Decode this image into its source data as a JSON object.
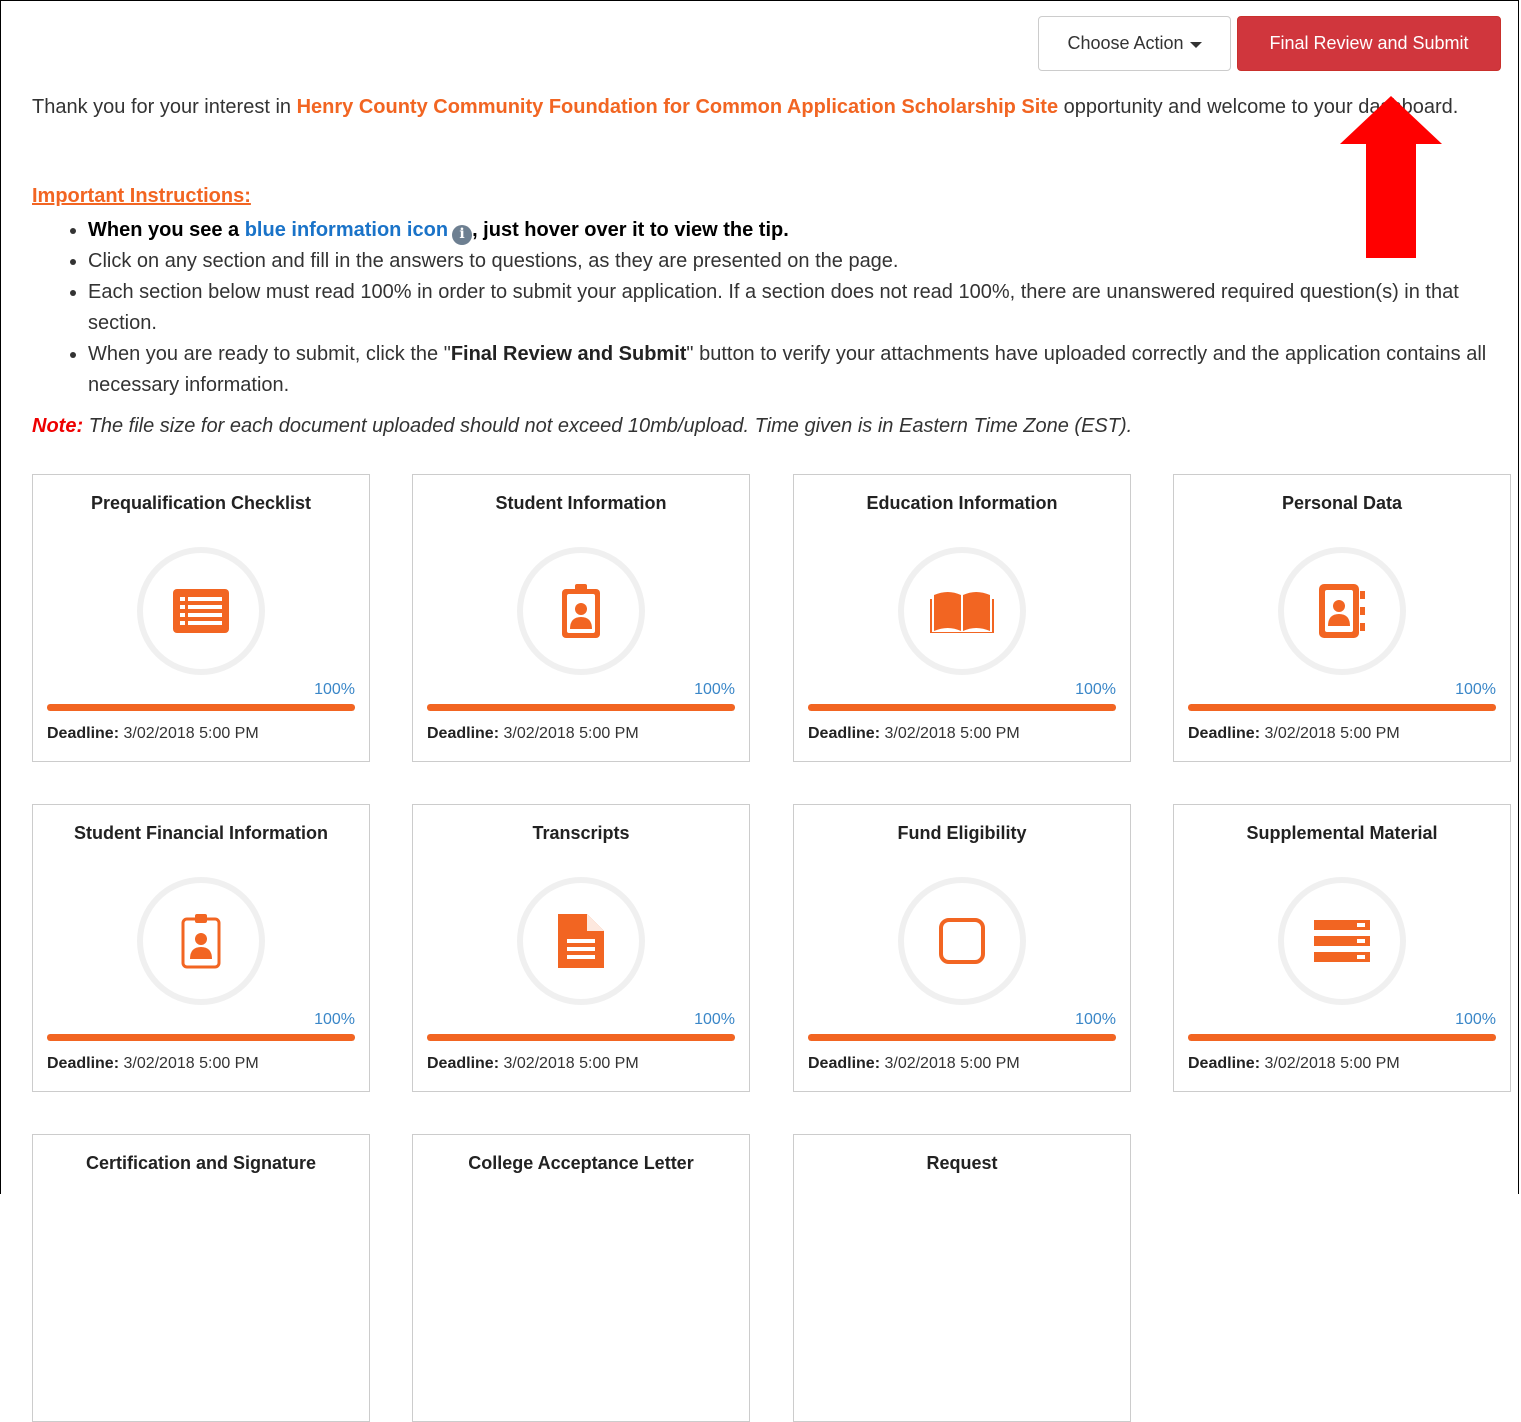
{
  "header": {
    "choose_action_label": "Choose Action",
    "final_submit_label": "Final Review and Submit"
  },
  "intro": {
    "prefix": "Thank you for your interest in ",
    "organization": "Henry County Community Foundation for Common Application Scholarship Site",
    "suffix": " opportunity and welcome to your dashboard."
  },
  "instructions": {
    "heading": "Important Instructions:",
    "item1_pre": "When you see a ",
    "item1_blue": "blue information icon",
    "item1_post": ", just hover over it to view the tip.",
    "item2": "Click on any section and fill in the answers to questions, as they are presented on the page.",
    "item3": "Each section below must read 100% in order to submit your application. If a section does not read 100%, there are unanswered required question(s) in that section.",
    "item4_pre": "When you are ready to submit, click the \"",
    "item4_bold": "Final Review and Submit",
    "item4_post": "\" button to verify your attachments have uploaded correctly and the application contains all necessary information."
  },
  "note": {
    "label": "Note:",
    "text": " The file size for each document uploaded should not exceed 10mb/upload. Time given is in Eastern Time Zone (EST)."
  },
  "deadline_label": "Deadline:",
  "accent_color": "#f26522",
  "sections": [
    {
      "title": "Prequalification Checklist",
      "icon": "checklist-icon",
      "progress": 1.0,
      "progress_label": "100%",
      "deadline": "3/02/2018 5:00 PM"
    },
    {
      "title": "Student Information",
      "icon": "id-badge-icon",
      "progress": 1.0,
      "progress_label": "100%",
      "deadline": "3/02/2018 5:00 PM"
    },
    {
      "title": "Education Information",
      "icon": "open-book-icon",
      "progress": 1.0,
      "progress_label": "100%",
      "deadline": "3/02/2018 5:00 PM"
    },
    {
      "title": "Personal Data",
      "icon": "address-book-icon",
      "progress": 1.0,
      "progress_label": "100%",
      "deadline": "3/02/2018 5:00 PM"
    },
    {
      "title": "Student Financial Information",
      "icon": "id-badge-outline-icon",
      "progress": 1.0,
      "progress_label": "100%",
      "deadline": "3/02/2018 5:00 PM"
    },
    {
      "title": "Transcripts",
      "icon": "document-icon",
      "progress": 1.0,
      "progress_label": "100%",
      "deadline": "3/02/2018 5:00 PM"
    },
    {
      "title": "Fund Eligibility",
      "icon": "square-outline-icon",
      "progress": 1.0,
      "progress_label": "100%",
      "deadline": "3/02/2018 5:00 PM"
    },
    {
      "title": "Supplemental Material",
      "icon": "server-stack-icon",
      "progress": 1.0,
      "progress_label": "100%",
      "deadline": "3/02/2018 5:00 PM"
    },
    {
      "title": "Certification and Signature"
    },
    {
      "title": "College Acceptance Letter"
    },
    {
      "title": "Request"
    }
  ]
}
